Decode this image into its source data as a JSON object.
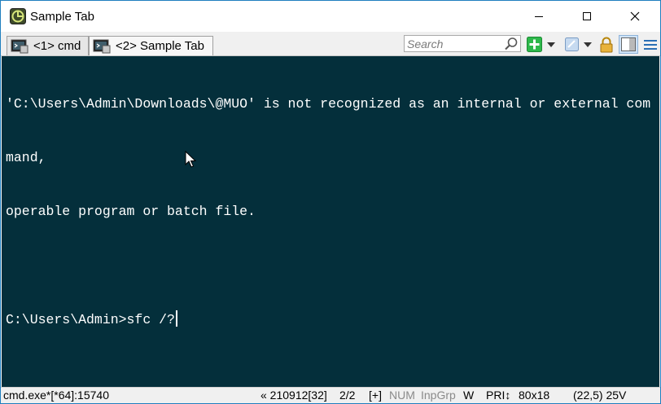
{
  "window": {
    "title": "Sample Tab"
  },
  "tabs": [
    {
      "label": "<1> cmd"
    },
    {
      "label": "<2> Sample Tab"
    }
  ],
  "search": {
    "placeholder": "Search"
  },
  "toolbar": {
    "icons": [
      "new-console-icon",
      "dropdown-arrow-icon",
      "paste-icon",
      "lock-icon",
      "panels-icon",
      "menu-icon"
    ]
  },
  "console": {
    "lines": [
      "'C:\\Users\\Admin\\Downloads\\@MUO' is not recognized as an internal or external com",
      "mand,",
      "operable program or batch file.",
      "",
      "C:\\Users\\Admin>sfc /?"
    ],
    "background": "#042f3b",
    "foreground": "#ffffff"
  },
  "status": {
    "process": "cmd.exe*[*64]:15740",
    "buffer": "« 210912[32]",
    "pages": "2/2",
    "plus": "[+]",
    "num": "NUM",
    "inpgrp": "InpGrp",
    "w": "W",
    "pri": "PRI↕",
    "size": "80x18",
    "cursor_pos": "(22,5) 25V"
  },
  "colors": {
    "accent": "#1f7fbf",
    "new_console_green": "#2db84b"
  }
}
